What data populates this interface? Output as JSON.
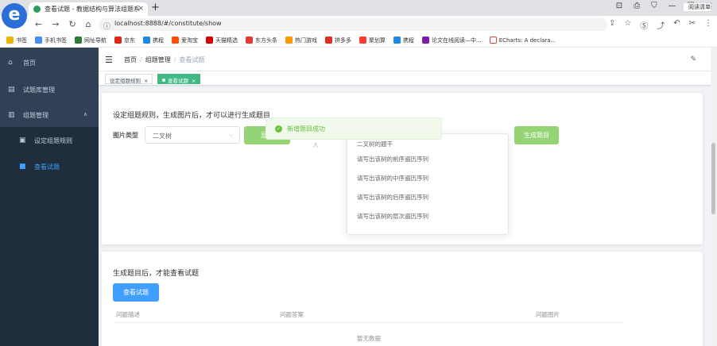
{
  "browser": {
    "logo_letter": "e",
    "tab_title": "查看试题 - 教据结构与算法组题系",
    "tab_close": "×",
    "new_tab": "+",
    "address": "localhost:8888/#/constitute/show",
    "window_controls": [
      "⊡",
      "⎙",
      "⛉",
      "—",
      "☐",
      "✕"
    ],
    "nav_buttons": [
      "←",
      "→",
      "↻",
      "⌂"
    ],
    "nav_right_icons": [
      "⇪",
      "☆",
      "Ⓢ",
      "⤴",
      "↶",
      "✂",
      "⋮"
    ],
    "bookmarks": [
      {
        "label": "书签",
        "color": "#f0b400"
      },
      {
        "label": "手机书签",
        "color": "#4a8af4"
      },
      {
        "label": "网址导航",
        "color": "#2e7d32"
      },
      {
        "label": "京东",
        "color": "#e1251b"
      },
      {
        "label": "携程",
        "color": "#1e88e5"
      },
      {
        "label": "爱淘宝",
        "color": "#ff5000"
      },
      {
        "label": "天猫精选",
        "color": "#d50000"
      },
      {
        "label": "东方头条",
        "color": "#e53935"
      },
      {
        "label": "热门游戏",
        "color": "#ff9800"
      },
      {
        "label": "拼多多",
        "color": "#e02e24"
      },
      {
        "label": "聚划算",
        "color": "#ff3b30"
      },
      {
        "label": "携程",
        "color": "#1e88e5"
      },
      {
        "label": "论文在线阅读—中...",
        "color": "#7b1fa2"
      },
      {
        "label": "ECharts: A declara...",
        "color": "#ffffff"
      }
    ],
    "reading_list": "阅读清单"
  },
  "sidebar": {
    "items": [
      {
        "label": "首页",
        "icon": "⌂"
      },
      {
        "label": "试题库管理",
        "icon": "▤"
      },
      {
        "label": "组题管理",
        "icon": "▥",
        "arrow": "∧"
      },
      {
        "label": "设定组题规则",
        "icon": "▣"
      },
      {
        "label": "查看试题",
        "icon": "■"
      }
    ]
  },
  "header": {
    "hamburger": "☰",
    "crumbs": [
      "首页",
      "组题管理",
      "查看试题"
    ],
    "separator": "/",
    "edit_icon": "✎"
  },
  "tags": [
    {
      "label": "设定组题规则",
      "close": "×"
    },
    {
      "label": "查看试题",
      "close": "×"
    }
  ],
  "card1": {
    "title": "设定组题规则，生成图片后，才可以进行生成题目",
    "label": "图片类型",
    "select_value": "二叉树",
    "select_chevron": "⌵",
    "show_button": "显示",
    "generate_button": "生成题目",
    "tree_icon": "⋏"
  },
  "toast": {
    "icon": "✓",
    "message": "新增题目成功"
  },
  "dropdown": {
    "items": [
      "二叉树的题干",
      "请写出该树的前序遍历序列",
      "请写出该树的中序遍历序列",
      "请写出该树的后序遍历序列",
      "请写出该树的层次遍历序列"
    ]
  },
  "card2": {
    "title": "生成题目后，才能查看试题",
    "view_button": "查看试题",
    "columns": [
      "问题描述",
      "问题答案",
      "问题图片"
    ],
    "empty_text": "暂无数据"
  },
  "colors": {
    "sidebar_bg": "#304156",
    "active": "#409eff",
    "tag_active": "#42b983",
    "success": "#67c23a",
    "button_disabled_green": "#95d475"
  }
}
